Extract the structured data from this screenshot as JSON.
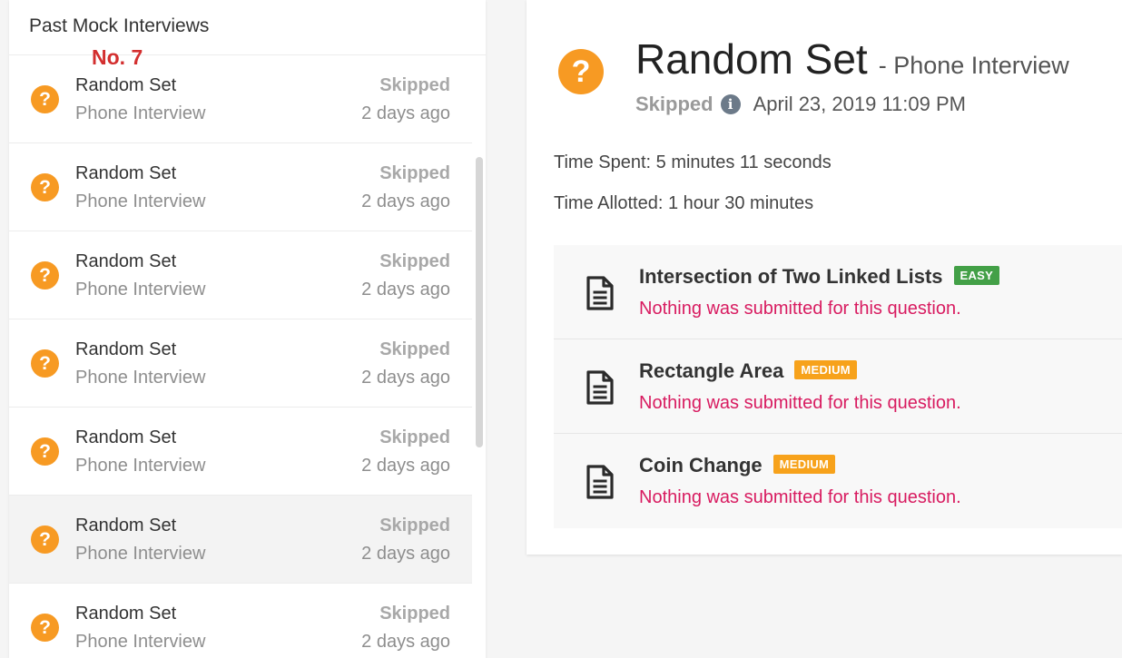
{
  "annotation": "No. 7",
  "sidebar": {
    "title": "Past Mock Interviews",
    "items": [
      {
        "title": "Random Set",
        "subtitle": "Phone Interview",
        "status": "Skipped",
        "time": "2 days ago",
        "icon": "question-circle-icon"
      },
      {
        "title": "Random Set",
        "subtitle": "Phone Interview",
        "status": "Skipped",
        "time": "2 days ago",
        "icon": "question-circle-icon"
      },
      {
        "title": "Random Set",
        "subtitle": "Phone Interview",
        "status": "Skipped",
        "time": "2 days ago",
        "icon": "question-circle-icon"
      },
      {
        "title": "Random Set",
        "subtitle": "Phone Interview",
        "status": "Skipped",
        "time": "2 days ago",
        "icon": "question-circle-icon"
      },
      {
        "title": "Random Set",
        "subtitle": "Phone Interview",
        "status": "Skipped",
        "time": "2 days ago",
        "icon": "question-circle-icon"
      },
      {
        "title": "Random Set",
        "subtitle": "Phone Interview",
        "status": "Skipped",
        "time": "2 days ago",
        "icon": "question-circle-icon"
      },
      {
        "title": "Random Set",
        "subtitle": "Phone Interview",
        "status": "Skipped",
        "time": "2 days ago",
        "icon": "question-circle-icon"
      }
    ],
    "selected_index": 5
  },
  "detail": {
    "title": "Random Set",
    "type": "- Phone Interview",
    "status": "Skipped",
    "date": "April 23, 2019 11:09 PM",
    "time_spent": "Time Spent: 5 minutes 11 seconds",
    "time_allotted": "Time Allotted: 1 hour 30 minutes",
    "questions": [
      {
        "title": "Intersection of Two Linked Lists",
        "difficulty": "EASY",
        "note": "Nothing was submitted for this question."
      },
      {
        "title": "Rectangle Area",
        "difficulty": "MEDIUM",
        "note": "Nothing was submitted for this question."
      },
      {
        "title": "Coin Change",
        "difficulty": "MEDIUM",
        "note": "Nothing was submitted for this question."
      }
    ]
  },
  "colors": {
    "accent_orange": "#f79a23",
    "easy_green": "#43a047",
    "medium_orange": "#f7a21b",
    "note_pink": "#d81b60",
    "annotation_red": "#d32f2f"
  }
}
